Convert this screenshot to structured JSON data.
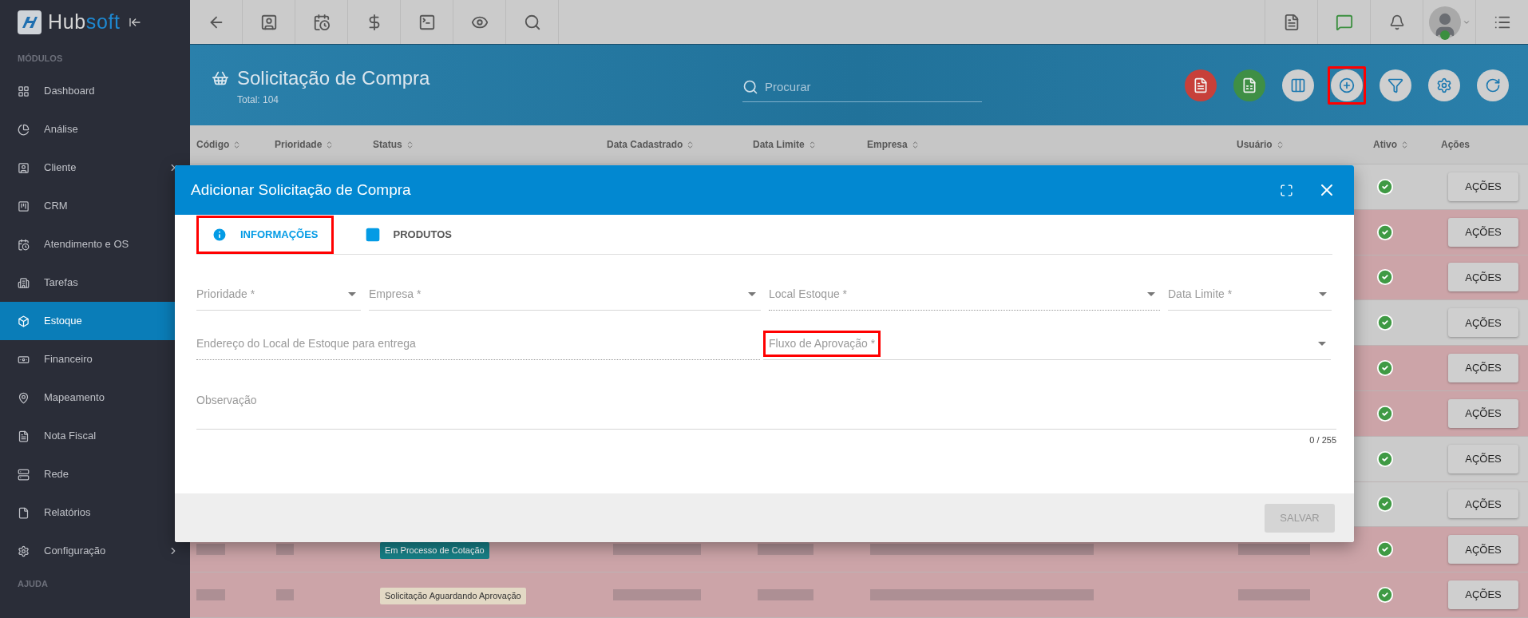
{
  "logo": {
    "part_1": "Hub",
    "part_2": "soft"
  },
  "sidebar": {
    "sections": [
      {
        "title": "MÓDULOS",
        "items": [
          {
            "label": "Dashboard",
            "selected": false,
            "has_submenu": false
          },
          {
            "label": "Análise",
            "selected": false,
            "has_submenu": false
          },
          {
            "label": "Cliente",
            "selected": false,
            "has_submenu": true
          },
          {
            "label": "CRM",
            "selected": false,
            "has_submenu": false
          },
          {
            "label": "Atendimento e OS",
            "selected": false,
            "has_submenu": false
          },
          {
            "label": "Tarefas",
            "selected": false,
            "has_submenu": false
          },
          {
            "label": "Estoque",
            "selected": true,
            "has_submenu": false
          },
          {
            "label": "Financeiro",
            "selected": false,
            "has_submenu": false
          },
          {
            "label": "Mapeamento",
            "selected": false,
            "has_submenu": false
          },
          {
            "label": "Nota Fiscal",
            "selected": false,
            "has_submenu": false
          },
          {
            "label": "Rede",
            "selected": false,
            "has_submenu": false
          },
          {
            "label": "Relatórios",
            "selected": false,
            "has_submenu": false
          },
          {
            "label": "Configuração",
            "selected": false,
            "has_submenu": true
          }
        ]
      },
      {
        "title": "AJUDA"
      }
    ]
  },
  "page_header": {
    "title": "Solicitação de Compra",
    "subtitle": "Total: 104",
    "search": {
      "placeholder": "Procurar"
    },
    "actions": [
      {
        "highlighted": false
      },
      {
        "highlighted": false
      },
      {
        "highlighted": false
      },
      {
        "highlighted": true
      },
      {
        "highlighted": false
      },
      {
        "highlighted": false
      },
      {
        "highlighted": false
      }
    ]
  },
  "table": {
    "columns": [
      {
        "label": "Código",
        "sortable": true
      },
      {
        "label": "Prioridade",
        "sortable": true
      },
      {
        "label": "Status",
        "sortable": true
      },
      {
        "label": "Data Cadastrado",
        "sortable": true
      },
      {
        "label": "Data Limite",
        "sortable": true
      },
      {
        "label": "Empresa",
        "sortable": true
      },
      {
        "label": "Usuário",
        "sortable": true
      },
      {
        "label": "Ativo",
        "sortable": true
      },
      {
        "label": "Ações",
        "sortable": false
      }
    ],
    "rows": [
      {
        "color": "#cbcbcb",
        "active": true,
        "action": "AÇÕES"
      },
      {
        "color": "#cca4a8",
        "active": true,
        "action": "AÇÕES"
      },
      {
        "color": "#cca4a8",
        "active": true,
        "action": "AÇÕES"
      },
      {
        "color": "#cbcbcb",
        "active": true,
        "action": "AÇÕES"
      },
      {
        "color": "#cca4a8",
        "active": true,
        "action": "AÇÕES"
      },
      {
        "color": "#cca4a8",
        "active": true,
        "action": "AÇÕES"
      },
      {
        "color": "#cbcbcb",
        "active": true,
        "action": "AÇÕES"
      },
      {
        "color": "#cbcbcb",
        "active": true,
        "action": "AÇÕES"
      },
      {
        "color": "#cca4a8",
        "active": true,
        "action": "AÇÕES",
        "status": {
          "text": "Em Processo de Cotação",
          "color": "#177f86"
        }
      },
      {
        "color": "#cca4a8",
        "active": true,
        "action": "AÇÕES",
        "status": {
          "text": "Solicitação Aguardando Aprovação",
          "color": "#e3d9c5"
        }
      }
    ]
  },
  "modal": {
    "title": "Adicionar Solicitação de Compra",
    "tabs": [
      {
        "label": "INFORMAÇÕES",
        "selected": true,
        "highlighted": true
      },
      {
        "label": "PRODUTOS",
        "selected": false,
        "highlighted": false
      }
    ],
    "rows": [
      {
        "fields": [
          {
            "kind": "select",
            "placeholder": "Prioridade *",
            "disabled": false,
            "highlighted": false
          },
          {
            "kind": "select",
            "placeholder": "Empresa *",
            "disabled": false,
            "highlighted": false
          },
          {
            "kind": "select",
            "placeholder": "Local Estoque *",
            "disabled": true,
            "highlighted": false
          },
          {
            "kind": "select",
            "placeholder": "Data Limite *",
            "disabled": false,
            "highlighted": false
          }
        ]
      },
      {
        "fields": [
          {
            "kind": "text",
            "placeholder": "Endereço do Local de Estoque para entrega",
            "disabled": true,
            "highlighted": false
          },
          {
            "kind": "select",
            "placeholder": "Fluxo de Aprovação *",
            "disabled": false,
            "highlighted": true
          }
        ]
      }
    ],
    "notes": {
      "placeholder": "Observação",
      "counter": "0 / 255"
    },
    "save": {
      "label": "SALVAR",
      "disabled": true
    }
  }
}
